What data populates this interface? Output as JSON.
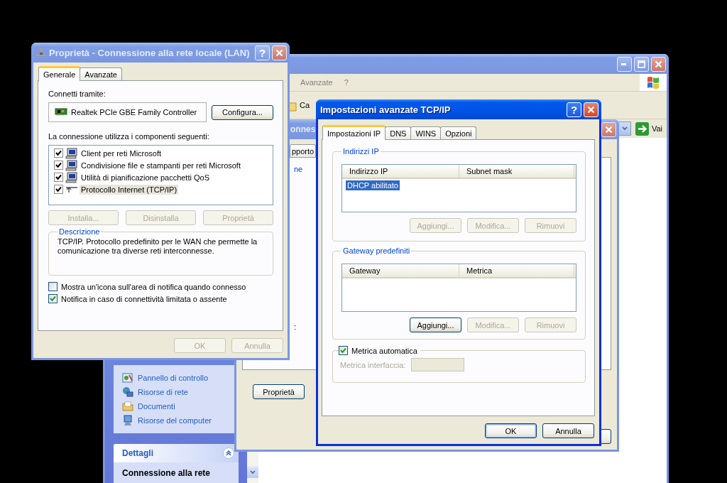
{
  "explorer": {
    "active": false,
    "menu": [
      "Avanzate",
      "?"
    ],
    "toolbar_button": "Ca",
    "go_button": "Vai",
    "tasks": [
      {
        "label": "Pannello di controllo",
        "kind": "control-panel"
      },
      {
        "label": "Risorse di rete",
        "kind": "network"
      },
      {
        "label": "Documenti",
        "kind": "documents"
      },
      {
        "label": "Risorse del computer",
        "kind": "computer"
      }
    ],
    "details": {
      "title": "Dettagli",
      "text": "Connessione alla rete"
    }
  },
  "status_window": {
    "active": false,
    "title": "onnes",
    "tab": "pporto",
    "group": "ne",
    "label": ":",
    "button": "Proprietà"
  },
  "lan_dialog": {
    "active": false,
    "title": "Proprietà - Connessione alla rete locale (LAN)",
    "help_button": "?",
    "tabs": [
      {
        "label": "Generale",
        "selected": true
      },
      {
        "label": "Avanzate",
        "selected": false
      }
    ],
    "connect_label": "Connetti tramite:",
    "adapter": "Realtek PCIe GBE Family Controller",
    "configure_button": "Configura...",
    "components_label": "La connessione utilizza i componenti seguenti:",
    "components": [
      {
        "name": "Client per reti Microsoft",
        "kind": "client",
        "checked": true,
        "selected": false
      },
      {
        "name": "Condivisione file e stampanti per reti Microsoft",
        "kind": "service",
        "checked": true,
        "selected": false
      },
      {
        "name": "Utilità di pianificazione pacchetti QoS",
        "kind": "service",
        "checked": true,
        "selected": false
      },
      {
        "name": "Protocollo Internet (TCP/IP)",
        "kind": "protocol",
        "checked": true,
        "selected": true
      }
    ],
    "component_buttons": [
      {
        "label": "Installa...",
        "disabled": true
      },
      {
        "label": "Disinstalla",
        "disabled": true
      },
      {
        "label": "Proprietà",
        "disabled": true
      }
    ],
    "description": {
      "title": "Descrizione",
      "text": "TCP/IP. Protocollo predefinito per le WAN che permette la comunicazione tra diverse reti interconnesse."
    },
    "options": [
      {
        "label": "Mostra un'icona sull'area di notifica quando connesso",
        "checked": false
      },
      {
        "label": "Notifica in caso di connettività limitata o assente",
        "checked": true
      }
    ],
    "buttons": [
      {
        "label": "OK",
        "disabled": true
      },
      {
        "label": "Annulla",
        "disabled": true
      }
    ]
  },
  "tcp_dialog": {
    "active": true,
    "title": "Impostazioni avanzate TCP/IP",
    "help_button": "?",
    "tabs": [
      {
        "label": "Impostazioni IP",
        "selected": true
      },
      {
        "label": "DNS",
        "selected": false
      },
      {
        "label": "WINS",
        "selected": false
      },
      {
        "label": "Opzioni",
        "selected": false
      }
    ],
    "ip_group": {
      "title": "Indirizzi IP",
      "columns": [
        "Indirizzo IP",
        "Subnet mask"
      ],
      "rows": [
        {
          "cells": [
            "DHCP abilitato"
          ],
          "selected": true
        }
      ],
      "buttons": [
        {
          "label": "Aggiungi...",
          "disabled": true
        },
        {
          "label": "Modifica...",
          "disabled": true
        },
        {
          "label": "Rimuovi",
          "disabled": true
        }
      ]
    },
    "gateway_group": {
      "title": "Gateway predefiniti",
      "columns": [
        "Gateway",
        "Metrica"
      ],
      "buttons": [
        {
          "label": "Aggiungi...",
          "disabled": false
        },
        {
          "label": "Modifica...",
          "disabled": true
        },
        {
          "label": "Rimuovi",
          "disabled": true
        }
      ]
    },
    "metric": {
      "label": "Metrica automatica",
      "checked": true,
      "field_label": "Metrica interfaccia:",
      "disabled": true
    },
    "buttons": [
      {
        "label": "OK",
        "default": true
      },
      {
        "label": "Annulla",
        "default": false
      }
    ]
  }
}
